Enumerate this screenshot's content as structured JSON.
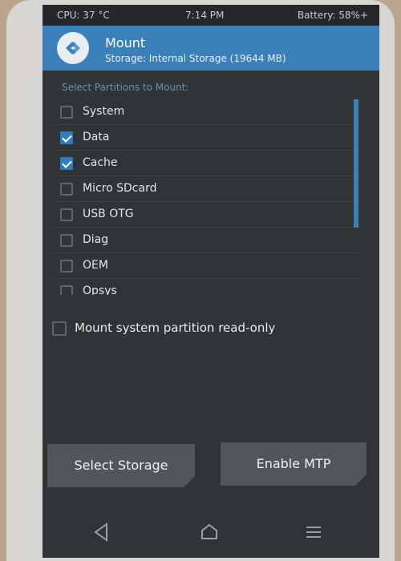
{
  "status_bar": {
    "cpu": "CPU: 37 °C",
    "time": "7:14 PM",
    "battery": "Battery: 58%+"
  },
  "header": {
    "title": "Mount",
    "subtitle": "Storage: Internal Storage (19644 MB)"
  },
  "partitions": {
    "section_label": "Select Partitions to Mount:",
    "items": [
      {
        "label": "System",
        "checked": false
      },
      {
        "label": "Data",
        "checked": true
      },
      {
        "label": "Cache",
        "checked": true
      },
      {
        "label": "Micro SDcard",
        "checked": false
      },
      {
        "label": "USB OTG",
        "checked": false
      },
      {
        "label": "Diag",
        "checked": false
      },
      {
        "label": "OEM",
        "checked": false
      },
      {
        "label": "Opsys",
        "checked": false
      }
    ]
  },
  "readonly_option": {
    "label": "Mount system partition read-only",
    "checked": false
  },
  "buttons": {
    "select_storage": "Select Storage",
    "enable_mtp": "Enable MTP"
  },
  "nav_icons": [
    "back-icon",
    "home-icon",
    "menu-icon"
  ],
  "colors": {
    "accent": "#3b80b9",
    "background": "#303436",
    "button": "#50565a"
  }
}
